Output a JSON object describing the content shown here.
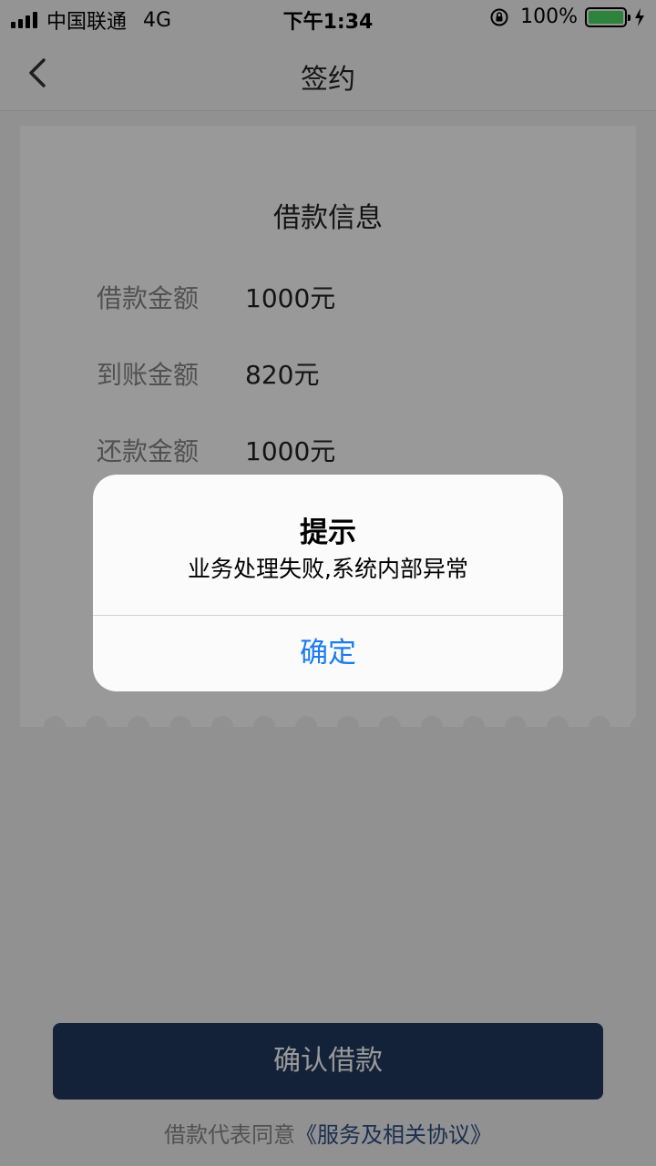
{
  "status_bar": {
    "carrier": "中国联通",
    "network": "4G",
    "time": "下午1:34",
    "battery_percent": "100%",
    "battery_level": 1.0
  },
  "nav": {
    "title": "签约",
    "back_icon": "chevron-left-icon"
  },
  "card": {
    "title": "借款信息",
    "rows": [
      {
        "label": "借款金额",
        "value": "1000元"
      },
      {
        "label": "到账金额",
        "value": "820元"
      },
      {
        "label": "还款金额",
        "value": "1000元"
      }
    ]
  },
  "footer": {
    "confirm_label": "确认借款",
    "agreement_prefix": "借款代表同意",
    "agreement_link": "《服务及相关协议》"
  },
  "dialog": {
    "title": "提示",
    "message": "业务处理失败,系统内部异常",
    "ok_label": "确定"
  },
  "colors": {
    "accent": "#1a7cf0",
    "button": "#203a5e",
    "battery": "#4cd964"
  }
}
